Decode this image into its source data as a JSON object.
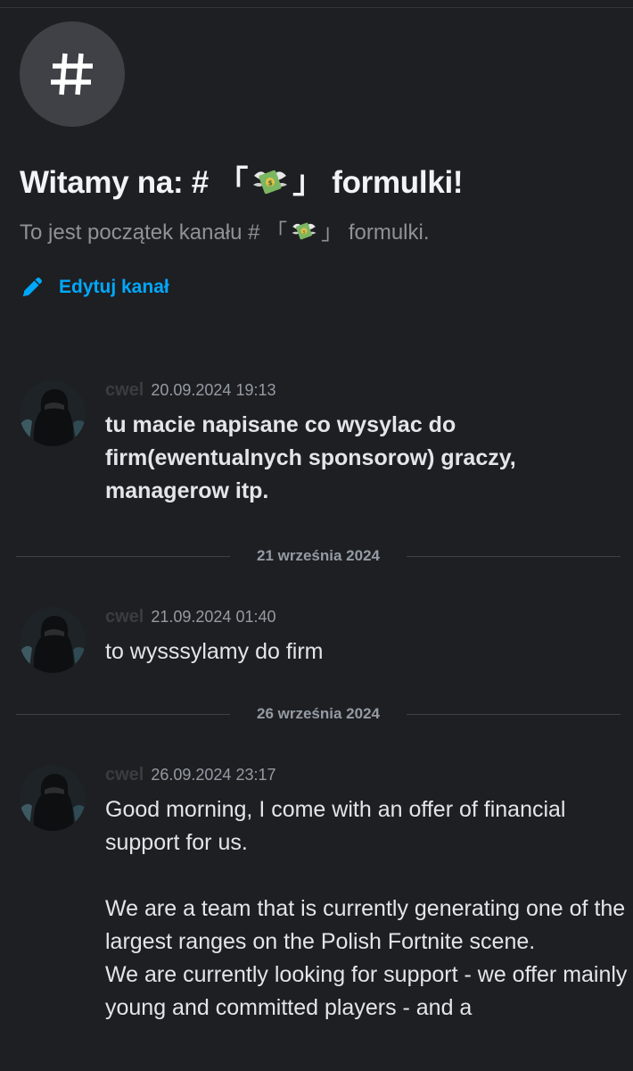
{
  "channel": {
    "icon": "hash-icon",
    "welcome_prefix": "Witamy na: # 「",
    "welcome_suffix": "」 formulki!",
    "sub_prefix": "To jest początek kanału # 「",
    "sub_suffix": "」 formulki.",
    "emoji": "money-with-wings-icon",
    "edit_label": "Edytuj kanał",
    "edit_icon": "pencil-icon"
  },
  "messages": [
    {
      "author": "cwel",
      "timestamp": "20.09.2024 19:13",
      "bold": true,
      "paragraphs": [
        "tu macie napisane co wysylac do firm(ewentualnych sponsorow) graczy, managerow itp."
      ]
    },
    {
      "author": "cwel",
      "timestamp": "21.09.2024 01:40",
      "bold": false,
      "paragraphs": [
        "to wysssylamy do firm"
      ]
    },
    {
      "author": "cwel",
      "timestamp": "26.09.2024 23:17",
      "bold": false,
      "paragraphs": [
        "Good morning, I come with an offer of financial support for us.",
        "We are a team that is currently generating one of the largest ranges on the Polish Fortnite scene.",
        "We are currently looking for support - we offer mainly young and committed players - and a"
      ]
    }
  ],
  "dividers": [
    "21 września 2024",
    "26 września 2024"
  ],
  "colors": {
    "background": "#1e1f22",
    "link": "#00a8fc",
    "muted": "#949ba4"
  }
}
